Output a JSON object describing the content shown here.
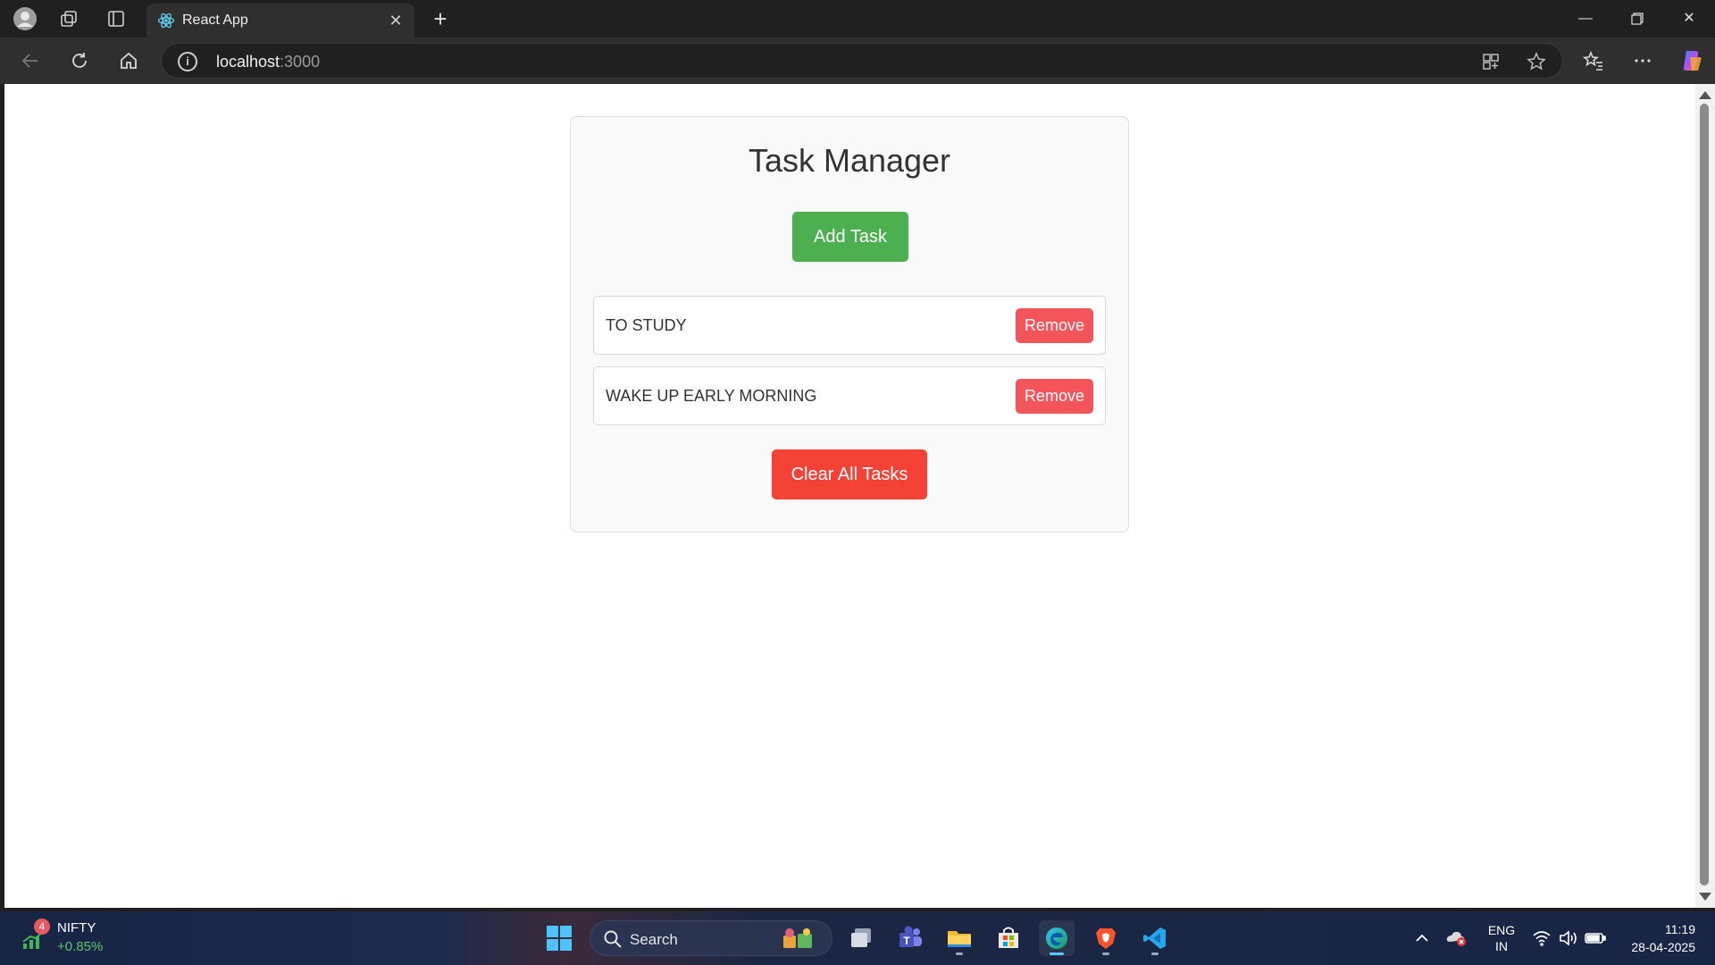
{
  "browser": {
    "tab_title": "React App",
    "url_host": "localhost",
    "url_port": ":3000"
  },
  "app": {
    "title": "Task Manager",
    "add_label": "Add Task",
    "tasks": [
      {
        "text": "TO STUDY",
        "remove_label": "Remove"
      },
      {
        "text": "WAKE UP EARLY MORNING",
        "remove_label": "Remove"
      }
    ],
    "clear_label": "Clear All Tasks"
  },
  "taskbar": {
    "widget_name": "NIFTY",
    "widget_change": "+0.85%",
    "widget_badge": "4",
    "search_label": "Search",
    "language": "ENG",
    "region": "IN",
    "time": "11:19",
    "date": "28-04-2025"
  },
  "colors": {
    "add_button": "#4caf50",
    "remove_button": "#f4555a",
    "clear_button": "#f44336"
  },
  "icons": [
    "profile-icon",
    "workspaces-icon",
    "tab-actions-icon",
    "react-icon",
    "close-icon",
    "new-tab-icon",
    "back-icon",
    "refresh-icon",
    "home-icon",
    "info-icon",
    "app-available-icon",
    "favorite-icon",
    "favorites-icon",
    "more-icon",
    "copilot-icon"
  ]
}
